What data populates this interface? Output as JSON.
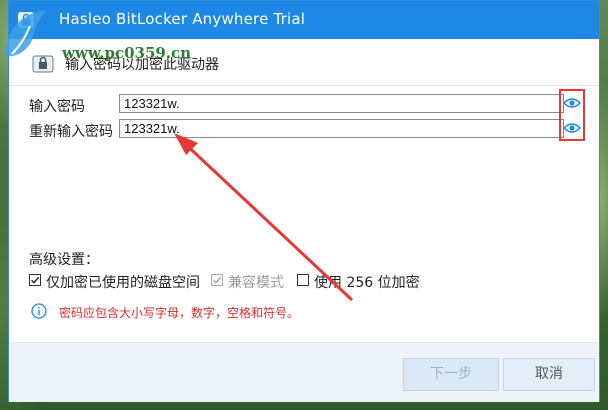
{
  "window": {
    "title": "Hasleo BitLocker Anywhere Trial"
  },
  "watermark": {
    "text": "www.pc0359.cn"
  },
  "header": {
    "text": "输入密码以加密此驱动器"
  },
  "password": {
    "label": "输入密码",
    "value": "123321w."
  },
  "confirm": {
    "label": "重新输入密码",
    "value": "123321w."
  },
  "advanced": {
    "title": "高级设置：",
    "options": [
      {
        "label": "仅加密已使用的磁盘空间",
        "checked": true,
        "enabled": true
      },
      {
        "label": "兼容模式",
        "checked": true,
        "enabled": false
      },
      {
        "label": "使用 256 位加密",
        "checked": false,
        "enabled": true
      }
    ]
  },
  "info": {
    "text": "密码应包含大小写字母，数字，空格和符号。"
  },
  "buttons": {
    "next": "下一步",
    "cancel": "取消"
  },
  "colors": {
    "titlebar": "#1e88e5",
    "annotation": "#e53935",
    "info_text": "#d32f2f"
  }
}
